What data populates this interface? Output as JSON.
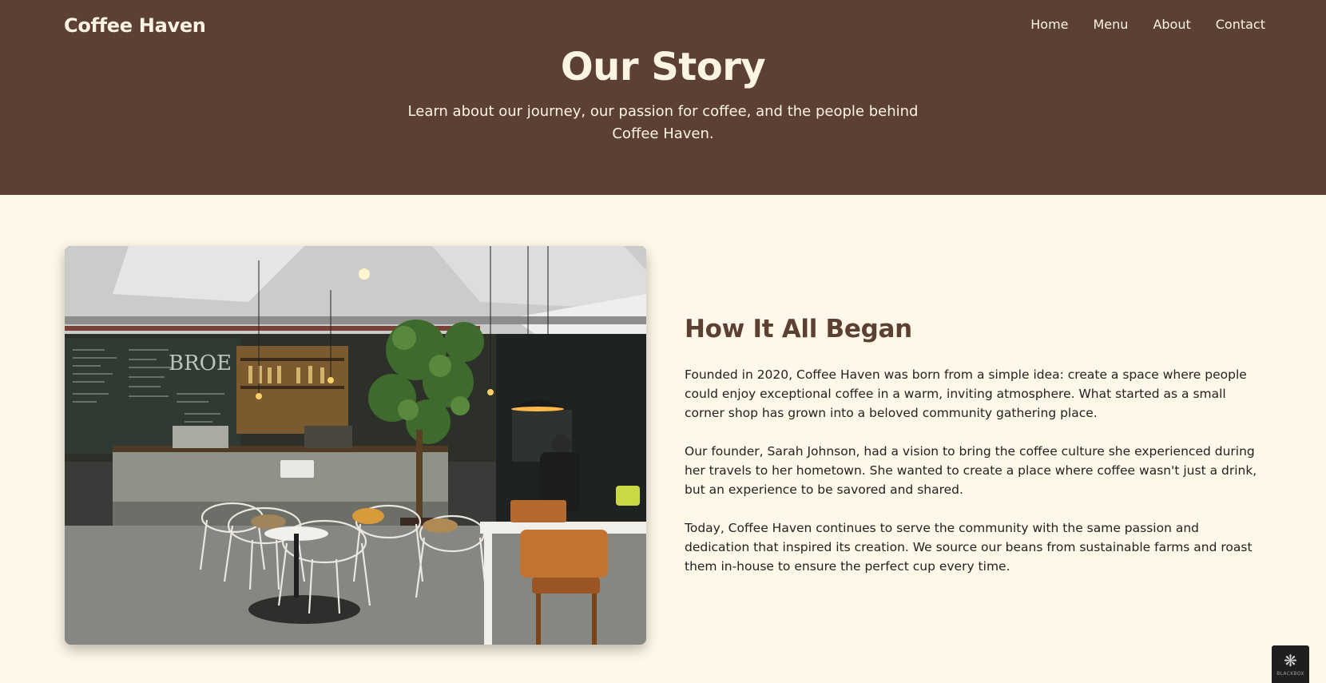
{
  "header": {
    "brand": "Coffee Haven",
    "nav": [
      "Home",
      "Menu",
      "About",
      "Contact"
    ]
  },
  "hero": {
    "title": "Our Story",
    "subtitle": "Learn about our journey, our passion for coffee, and the people behind Coffee Haven."
  },
  "story": {
    "heading": "How It All Began",
    "paragraphs": [
      "Founded in 2020, Coffee Haven was born from a simple idea: create a space where people could enjoy exceptional coffee in a warm, inviting atmosphere. What started as a small corner shop has grown into a beloved community gathering place.",
      "Our founder, Sarah Johnson, had a vision to bring the coffee culture she experienced during her travels to her hometown. She wanted to create a place where coffee wasn't just a drink, but an experience to be savored and shared.",
      "Today, Coffee Haven continues to serve the community with the same passion and dedication that inspired its creation. We source our beans from sustainable farms and roast them in-house to ensure the perfect cup every time."
    ],
    "image_icon": "cafe-interior-photo"
  },
  "badge": {
    "icon": "blackbox-logo-icon",
    "label": "BLACKBOX"
  },
  "colors": {
    "header_bg": "#5d4034",
    "page_bg": "#fff8e8",
    "accent": "#5d4034",
    "header_text": "#fdf4e3"
  }
}
